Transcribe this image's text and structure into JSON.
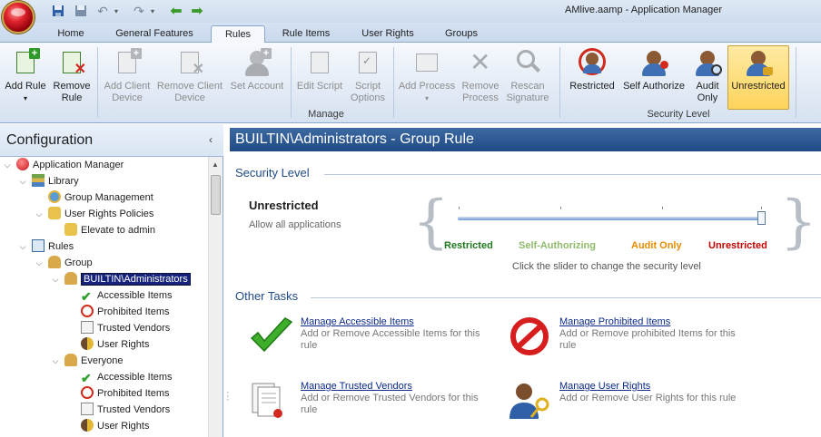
{
  "window": {
    "title": "AMlive.aamp - Application Manager"
  },
  "tabs": [
    "Home",
    "General Features",
    "Rules",
    "Rule Items",
    "User Rights",
    "Groups"
  ],
  "ribbon": {
    "buttons": {
      "add_rule": "Add Rule",
      "add_rule_arrow": "▾",
      "remove_rule": "Remove Rule",
      "add_client_device": "Add Client Device",
      "remove_client_device": "Remove Client Device",
      "set_account": "Set Account",
      "edit_script": "Edit Script",
      "script_options": "Script Options",
      "add_process": "Add Process",
      "add_process_arrow": "▾",
      "remove_process": "Remove Process",
      "rescan_signature": "Rescan Signature",
      "restricted": "Restricted",
      "self_authorize": "Self Authorize",
      "audit_only": "Audit Only",
      "unrestricted": "Unrestricted"
    },
    "groups": {
      "manage": "Manage",
      "security_level": "Security Level"
    }
  },
  "config": {
    "title": "Configuration",
    "collapse_glyph": "‹",
    "tree": {
      "application_manager": "Application Manager",
      "library": "Library",
      "group_management": "Group Management",
      "user_rights_policies": "User Rights Policies",
      "elevate_to_admin": "Elevate to admin",
      "rules": "Rules",
      "group": "Group",
      "builtin_admins": "BUILTIN\\Administrators",
      "accessible_items": "Accessible Items",
      "prohibited_items": "Prohibited Items",
      "trusted_vendors": "Trusted Vendors",
      "user_rights": "User Rights",
      "everyone": "Everyone",
      "accessible_items_2": "Accessible Items",
      "prohibited_items_2": "Prohibited Items",
      "trusted_vendors_2": "Trusted Vendors",
      "user_rights_2": "User Rights"
    }
  },
  "content": {
    "header": "BUILTIN\\Administrators - Group Rule",
    "security_level": {
      "title": "Security Level",
      "current": "Unrestricted",
      "description": "Allow all applications",
      "levels": [
        {
          "label": "Restricted",
          "color": "#1e7a1e"
        },
        {
          "label": "Self-Authorizing",
          "color": "#8fba6a"
        },
        {
          "label": "Audit Only",
          "color": "#e88c00"
        },
        {
          "label": "Unrestricted",
          "color": "#c40000"
        }
      ],
      "hint": "Click the slider to change the security level"
    },
    "other_tasks": {
      "title": "Other Tasks",
      "items": [
        {
          "link": "Manage Accessible Items",
          "desc": "Add or Remove Accessible Items for this rule"
        },
        {
          "link": "Manage Prohibited Items",
          "desc": "Add or Remove prohibited Items for this rule"
        },
        {
          "link": "Manage Trusted Vendors",
          "desc": "Add or Remove Trusted Vendors for this rule"
        },
        {
          "link": "Manage User Rights",
          "desc": "Add or Remove User Rights for this rule"
        }
      ]
    }
  }
}
